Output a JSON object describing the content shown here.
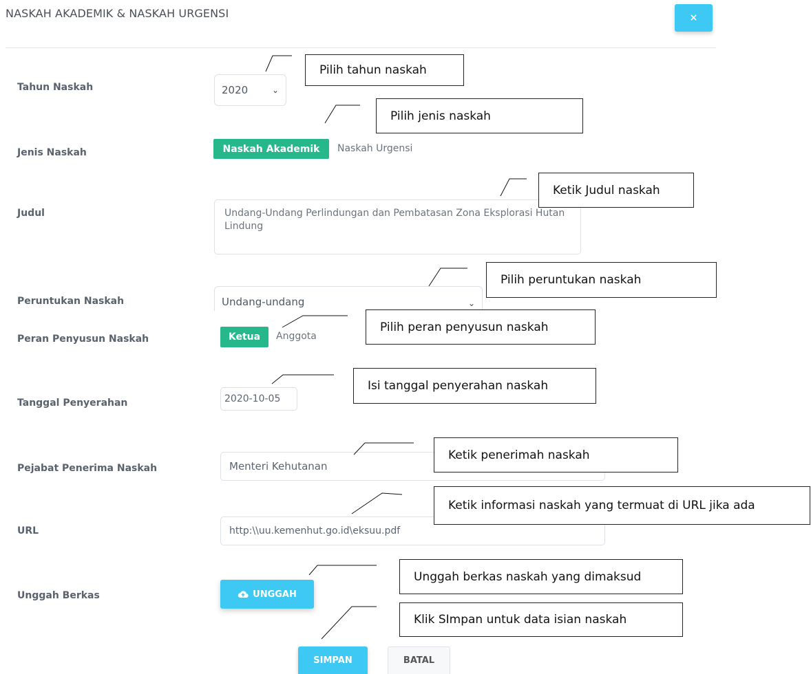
{
  "modal": {
    "title": "NASKAH AKADEMIK & NASKAH URGENSI",
    "close_label": "×"
  },
  "form": {
    "tahun": {
      "label": "Tahun Naskah",
      "value": "2020"
    },
    "jenis": {
      "label": "Jenis Naskah",
      "options": [
        "Naskah Akademik",
        "Naskah Urgensi"
      ],
      "selected": "Naskah Akademik"
    },
    "judul": {
      "label": "Judul",
      "value": "Undang-Undang Perlindungan dan Pembatasan Zona Eksplorasi Hutan Lindung"
    },
    "peruntukan": {
      "label": "Peruntukan Naskah",
      "value": "Undang-undang"
    },
    "peran": {
      "label": "Peran Penyusun Naskah",
      "options": [
        "Ketua",
        "Anggota"
      ],
      "selected": "Ketua"
    },
    "tanggal": {
      "label": "Tanggal Penyerahan",
      "value": "2020-10-05"
    },
    "pejabat": {
      "label": "Pejabat Penerima Naskah",
      "value": "Menteri Kehutanan"
    },
    "url": {
      "label": "URL",
      "value": "http:\\\\uu.kemenhut.go.id\\eksuu.pdf"
    },
    "berkas": {
      "label": "Unggah Berkas",
      "button_label": "UNGGAH"
    }
  },
  "actions": {
    "save_label": "SIMPAN",
    "cancel_label": "BATAL"
  },
  "callouts": [
    "Pilih tahun naskah",
    "Pilih jenis naskah",
    "Ketik Judul naskah",
    "Pilih peruntukan naskah",
    "Pilih peran penyusun naskah",
    "Isi tanggal penyerahan  naskah",
    "Ketik penerimah naskah",
    "Ketik informasi naskah yang termuat di URL jika ada",
    "Unggah berkas naskah yang dimaksud",
    "Klik SImpan untuk data isian naskah"
  ],
  "colors": {
    "accent": "#3ec8f4",
    "active_segment": "#26b88a"
  }
}
